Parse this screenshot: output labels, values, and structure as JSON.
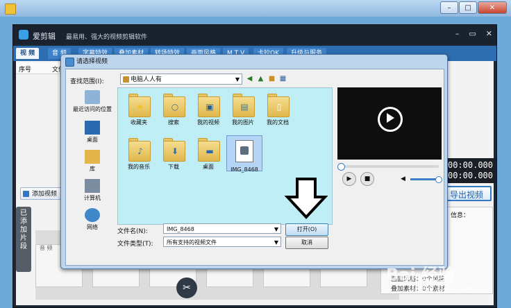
{
  "app": {
    "name": "爱剪辑",
    "slogan": "最易用、强大的视频剪辑软件",
    "menu": [
      "视 频",
      "音 频",
      "字幕特效",
      "叠加素材",
      "转场特效",
      "画面风格",
      "M T V",
      "卡拉OK",
      "升级与服务"
    ],
    "list_headers": [
      "序号",
      "文件"
    ],
    "add_video_label": "添加视频",
    "added_clips_label": "已添加片段",
    "clip_hint": "双击\n添加",
    "audio_label": "音 频",
    "time_display": [
      "00:00.000",
      "00:00.000"
    ],
    "export_label": "导出视频",
    "info_title": "信息：",
    "info_lines": [
      "画面风格：0个风格",
      "叠加素材：0个素材"
    ]
  },
  "dialog": {
    "title": "请选择视频",
    "look_in_label": "查找范围(I):",
    "look_in_value": "电脑人人有",
    "places": [
      {
        "label": "最近访问的位置",
        "icon": "recent-places-icon"
      },
      {
        "label": "桌面",
        "icon": "desktop-icon"
      },
      {
        "label": "库",
        "icon": "libraries-icon"
      },
      {
        "label": "计算机",
        "icon": "computer-icon"
      },
      {
        "label": "网络",
        "icon": "network-icon"
      }
    ],
    "files": [
      {
        "label": "收藏夹",
        "icon": "favorites-folder-icon"
      },
      {
        "label": "搜索",
        "icon": "search-folder-icon"
      },
      {
        "label": "我的视频",
        "icon": "videos-folder-icon"
      },
      {
        "label": "我的图片",
        "icon": "pictures-folder-icon"
      },
      {
        "label": "我的文档",
        "icon": "documents-folder-icon"
      },
      {
        "label": "我的音乐",
        "icon": "music-folder-icon"
      },
      {
        "label": "下载",
        "icon": "downloads-folder-icon"
      },
      {
        "label": "桌面",
        "icon": "desktop-folder-icon"
      },
      {
        "label": "IMG_8468",
        "icon": "video-file-icon"
      }
    ],
    "file_name_label": "文件名(N):",
    "file_name_value": "IMG_8468",
    "file_type_label": "文件类型(T):",
    "file_type_value": "所有支持的视频文件",
    "open_label": "打开(O)",
    "cancel_label": "取消"
  },
  "watermark": {
    "text": "Bai 经验",
    "sub": "jingyan.baidu.com"
  },
  "colors": {
    "menubar": "#2d6db0",
    "file_area": "#bfeef6",
    "export": "#2f78c4"
  }
}
